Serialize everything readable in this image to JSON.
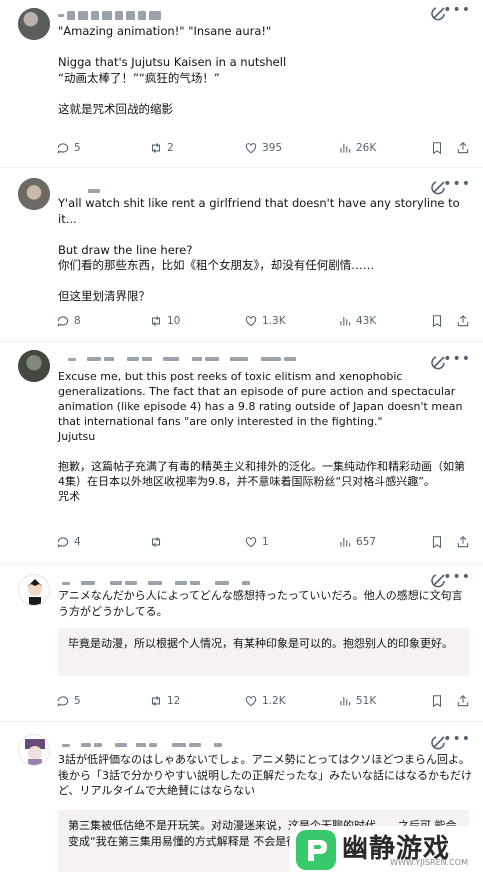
{
  "tweets": [
    {
      "text": "\"Amazing animation!\" \"Insane aura!\"\n\nNigga that's Jujutsu Kaisen in a nutshell\n“动画太棒了！”“疯狂的气场！”\n\n这就是咒术回战的缩影",
      "translation": "",
      "replies": "5",
      "reposts": "2",
      "likes": "395",
      "views": "26K"
    },
    {
      "text": "Y'all watch shit like rent a girlfriend that doesn't have any storyline to it...\n\nBut draw the line here?\n你们看的那些东西，比如《租个女朋友》，却没有任何剧情……\n\n但这里划清界限？",
      "translation": "",
      "replies": "8",
      "reposts": "10",
      "likes": "1.3K",
      "views": "43K"
    },
    {
      "text": "Excuse me, but this post reeks of toxic elitism and xenophobic generalizations. The fact that an episode of pure action and spectacular animation (like episode 4) has a 9.8 rating outside of Japan doesn't mean that international fans \"are only interested in the fighting.\"\nJujutsu\n\n抱歉，这篇帖子充满了有毒的精英主义和排外的泛化。一集纯动作和精彩动画（如第4集）在日本以外地区收视率为9.8，并不意味着国际粉丝“只对格斗感兴趣”。\n咒术",
      "translation": "",
      "replies": "4",
      "reposts": "",
      "likes": "1",
      "views": "657"
    },
    {
      "text": "アニメなんだから人によってどんな感想持ったっていいだろ。他人の感想に文句言う方がどうかしてる。",
      "translation": "毕竟是动漫，所以根据个人情况，有某种印象是可以的。抱怨别人的印象更好。",
      "replies": "5",
      "reposts": "12",
      "likes": "1.2K",
      "views": "51K"
    },
    {
      "text": "3話が低評価なのはしゃあないでしょ。アニメ勢にとってはクソほどつまらん回よ。後から「3話で分かりやすい説明したの正解だったな」みたいな話にはなるかもだけど、リアルタイムで大絶賛にはならない",
      "translation": "第三集被低估绝不是开玩笑。对动漫迷来说，这是个无聊的时代……之后可\n能会变成“我在第三集用易懂的方式解释是\n不会是很大的赞赏",
      "replies": "",
      "reposts": "",
      "likes": "",
      "views": ""
    }
  ],
  "watermark": {
    "title": "幽静游戏",
    "url": "WWW.YJISREN.COM"
  },
  "colors": {
    "text": "#0f1419",
    "muted": "#536471",
    "divider": "#eff3f4",
    "translation_bg": "#f7f2f2"
  }
}
